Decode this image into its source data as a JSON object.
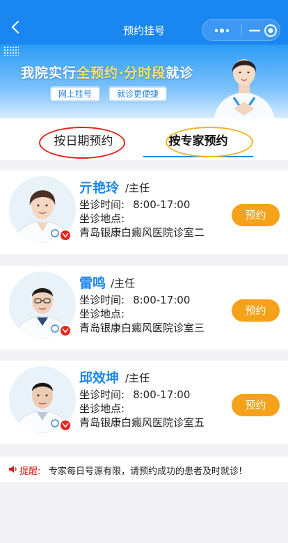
{
  "header": {
    "title": "预约挂号",
    "back_icon": "chevron-left-icon",
    "menu_icon": "more-dots-icon",
    "minimize_icon": "minus-icon",
    "close_icon": "target-close-icon"
  },
  "banner": {
    "headline_part1": "我院实行",
    "headline_highlight": "全预约·分时段",
    "headline_part2": "就诊",
    "pill_online": "网上挂号",
    "pill_convenient": "就诊更便捷",
    "highlight_color": "#ffe55c"
  },
  "tabs": [
    {
      "label": "按日期预约",
      "active": false
    },
    {
      "label": "按专家预约",
      "active": true
    }
  ],
  "doctors": [
    {
      "name": "亓艳玲",
      "title": "/主任",
      "time_label": "坐诊时间:",
      "time": "8:00-17:00",
      "place_label": "坐诊地点:",
      "place": "青岛银康白癜风医院诊室二",
      "book_label": "预约"
    },
    {
      "name": "雷鸣",
      "title": "/主任",
      "time_label": "坐诊时间:",
      "time": "8:00-17:00",
      "place_label": "坐诊地点:",
      "place": "青岛银康白癜风医院诊室三",
      "book_label": "预约"
    },
    {
      "name": "邱效坤",
      "title": "/主任",
      "time_label": "坐诊时间:",
      "time": "8:00-17:00",
      "place_label": "坐诊地点:",
      "place": "青岛银康白癜风医院诊室五",
      "book_label": "预约"
    }
  ],
  "notice": {
    "label": "提醒:",
    "text": "专家每日号源有限，请预约成功的患者及时就诊!"
  },
  "colors": {
    "brand_blue": "#1a86f0",
    "book_orange": "#f5a11a",
    "alert_red": "#d0221a"
  }
}
